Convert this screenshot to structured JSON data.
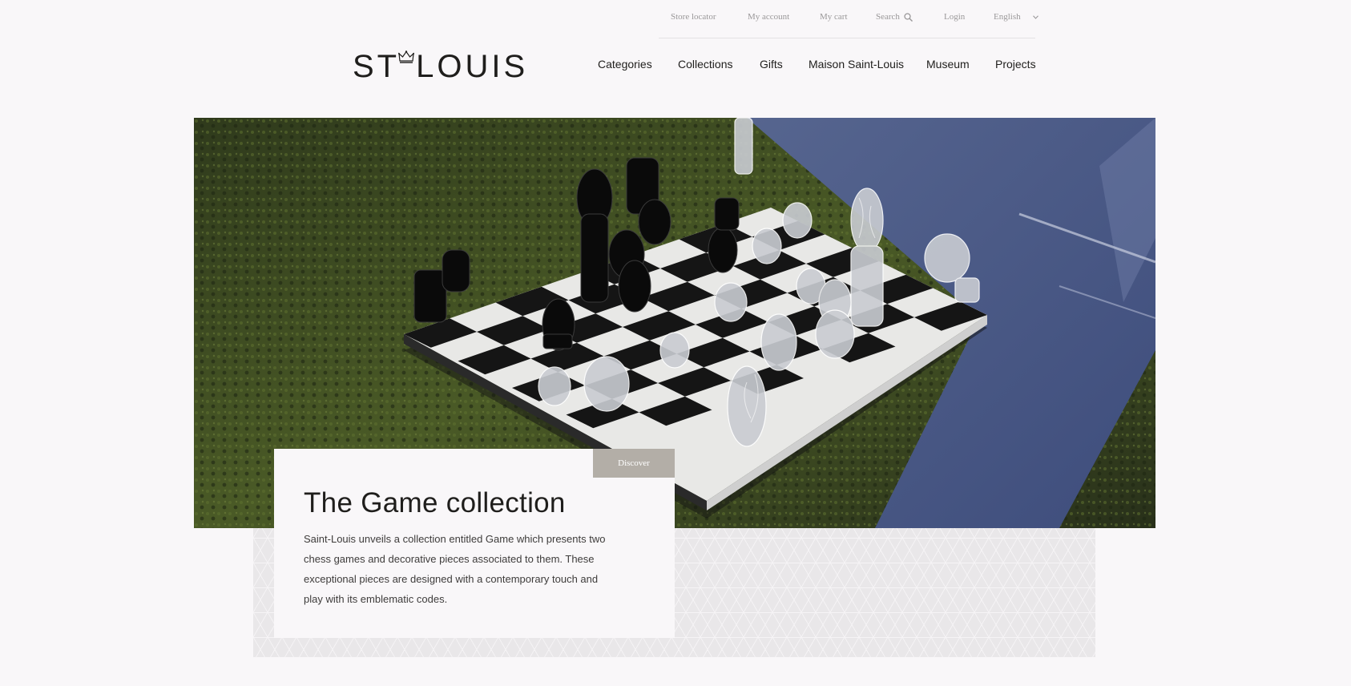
{
  "utility_nav": {
    "store_locator": "Store locator",
    "my_account": "My account",
    "my_cart": "My cart",
    "search": "Search",
    "search_icon": "search-icon",
    "login": "Login",
    "language": "English",
    "language_icon": "chevron-down-icon"
  },
  "logo": {
    "text_left": "ST",
    "text_right": "LOUIS",
    "crown_icon": "crown-icon"
  },
  "main_nav": {
    "items": [
      "Categories",
      "Collections",
      "Gifts",
      "Maison Saint-Louis",
      "Museum",
      "Projects"
    ]
  },
  "hero": {
    "image_description_icon": "chess-board-image",
    "discover_label": "Discover",
    "title": "The Game collection",
    "description": "Saint-Louis unveils a collection entitled Game which presents two chess games and decorative pieces associated to them. These exceptional pieces are designed with a contemporary touch and play with its emblematic codes."
  },
  "colors": {
    "background": "#f9f7f9",
    "text": "#1f1e1c",
    "muted": "#9a9899",
    "discover_button": "#b3aea7",
    "pattern": "#e9e7e9"
  }
}
